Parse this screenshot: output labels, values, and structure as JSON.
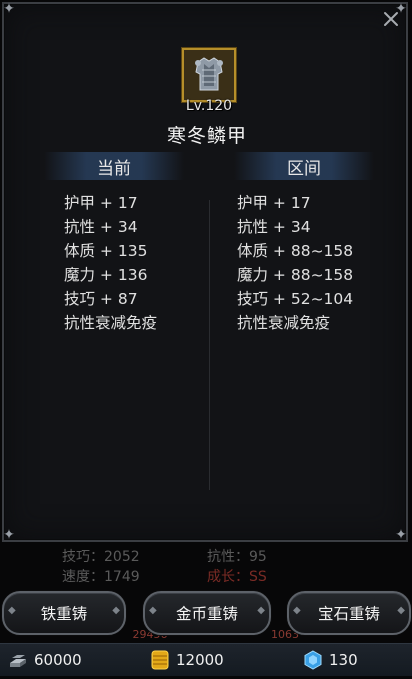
{
  "item": {
    "level": "Lv.120",
    "name": "寒冬鳞甲"
  },
  "columns": {
    "current_label": "当前",
    "range_label": "区间"
  },
  "current_stats": [
    "护甲 + 17",
    "抗性 + 34",
    "体质 + 135",
    "魔力 + 136",
    "技巧 + 87",
    "抗性衰减免疫"
  ],
  "range_stats": [
    "护甲 + 17",
    "抗性 + 34",
    "体质 + 88~158",
    "魔力 + 88~158",
    "技巧 + 52~104",
    "抗性衰减免疫"
  ],
  "background": {
    "skill": "技巧：2052",
    "speed": "速度：1749",
    "resist": "抗性：95",
    "growth": "成长：SS",
    "bar1": "29456",
    "bar2": "1063"
  },
  "buttons": {
    "iron_reforge": "铁重铸",
    "gold_reforge": "金币重铸",
    "gem_reforge": "宝石重铸"
  },
  "resources": {
    "iron": "60000",
    "gold": "12000",
    "gem": "130"
  },
  "colors": {
    "icon_border": "#b68f2a",
    "gem": "#3aa0e6",
    "gold": "#e2a818"
  }
}
